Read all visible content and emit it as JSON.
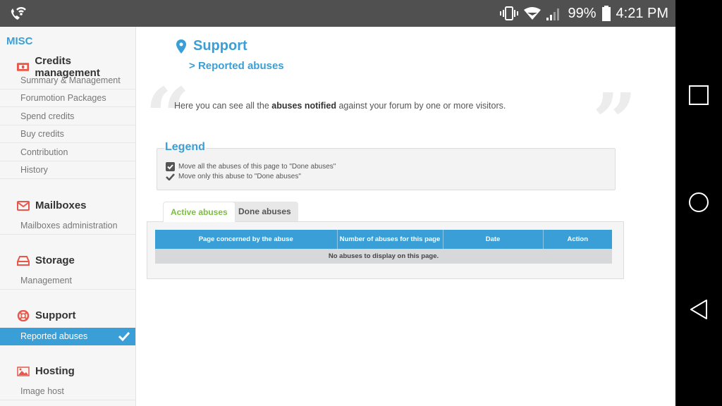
{
  "statusbar": {
    "left_icon": "wifi-calling-icon",
    "icons": [
      "vibrate-icon",
      "wifi-icon",
      "signal-icon",
      "battery-icon"
    ],
    "battery": "99%",
    "time": "4:21 PM"
  },
  "navbar": {
    "buttons": [
      "recent-apps",
      "home",
      "back"
    ]
  },
  "sidebar": {
    "section": "MISC",
    "groups": [
      {
        "title": "Credits management",
        "icon": "money-icon",
        "items": [
          "Summary & Management",
          "Forumotion Packages",
          "Spend credits",
          "Buy credits",
          "Contribution",
          "History"
        ]
      },
      {
        "title": "Mailboxes",
        "icon": "envelope-icon",
        "items": [
          "Mailboxes administration"
        ]
      },
      {
        "title": "Storage",
        "icon": "hard-drive-icon",
        "items": [
          "Management"
        ]
      },
      {
        "title": "Support",
        "icon": "lifebuoy-icon",
        "items": [
          "Reported abuses"
        ],
        "active_item": "Reported abuses"
      },
      {
        "title": "Hosting",
        "icon": "image-icon",
        "items": [
          "Image host"
        ]
      }
    ],
    "accent": "#3a9fd6",
    "icon_color": "#e8574a"
  },
  "main": {
    "title": "Support",
    "breadcrumb": "Reported abuses",
    "description_pre": "Here you can see all the ",
    "description_bold": "abuses notified",
    "description_post": " against your forum by one or more visitors.",
    "legend": {
      "title": "Legend",
      "rows": [
        "Move all the abuses of this page to \"Done abuses\"",
        "Move only this abuse to \"Done abuses\""
      ]
    },
    "tabs": [
      {
        "label": "Active abuses",
        "active": true
      },
      {
        "label": "Done abuses",
        "active": false
      }
    ],
    "table": {
      "headers": [
        "Page concerned by the abuse",
        "Number of abuses for this page",
        "Date",
        "Action"
      ],
      "empty_message": "No abuses to display on this page."
    }
  }
}
